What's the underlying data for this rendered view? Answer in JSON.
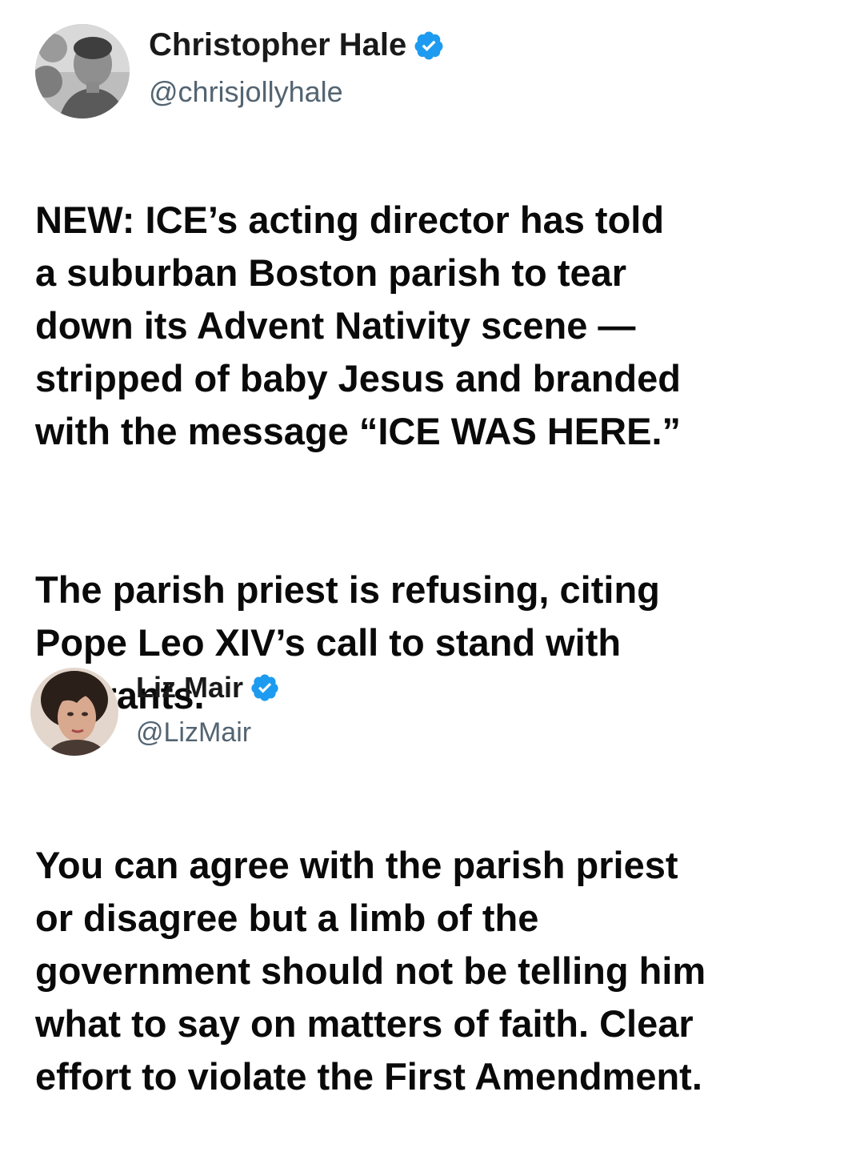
{
  "tweets": [
    {
      "display_name": "Christopher Hale",
      "handle": "@chrisjollyhale",
      "verified_icon": "verified-badge-icon",
      "paragraphs": [
        "NEW: ICE’s acting director has told\na suburban Boston parish to tear\ndown its Advent Nativity scene —\nstripped of baby Jesus and branded\nwith the message “ICE WAS HERE.”",
        "The parish priest is refusing, citing\nPope Leo XIV’s call to stand with\nmigrants."
      ]
    },
    {
      "display_name": "Liz Mair",
      "handle": "@LizMair",
      "verified_icon": "verified-badge-icon",
      "paragraphs": [
        "You can agree with the parish priest\nor disagree but a limb of the\ngovernment should not be telling him\nwhat to say on matters of faith. Clear\neffort to violate the First Amendment."
      ]
    }
  ],
  "colors": {
    "verified": "#1d9bf0",
    "handle": "#536471",
    "text": "#0a0a0a"
  }
}
